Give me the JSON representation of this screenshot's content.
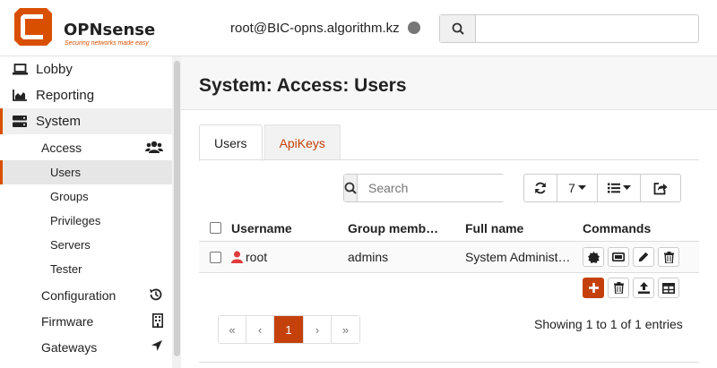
{
  "header": {
    "brand": "OPNsense",
    "tagline": "Securing networks made easy",
    "user_host": "root@BIC-opns.algorithm.kz",
    "search_placeholder": ""
  },
  "sidebar": {
    "items": [
      {
        "label": "Lobby",
        "icon": "laptop-icon"
      },
      {
        "label": "Reporting",
        "icon": "area-chart-icon"
      },
      {
        "label": "System",
        "icon": "server-icon"
      }
    ],
    "system_children": [
      {
        "label": "Access",
        "icon": "users-icon"
      },
      {
        "label": "Users"
      },
      {
        "label": "Groups"
      },
      {
        "label": "Privileges"
      },
      {
        "label": "Servers"
      },
      {
        "label": "Tester"
      },
      {
        "label": "Configuration",
        "icon": "history-icon"
      },
      {
        "label": "Firmware",
        "icon": "building-icon"
      },
      {
        "label": "Gateways",
        "icon": "location-arrow-icon"
      }
    ]
  },
  "page": {
    "title": "System: Access: Users",
    "tabs": [
      {
        "label": "Users",
        "active": true
      },
      {
        "label": "ApiKeys",
        "active": false
      }
    ]
  },
  "grid": {
    "search_placeholder": "Search",
    "page_size": "7",
    "columns": [
      "Username",
      "Group memb…",
      "Full name",
      "Commands"
    ],
    "rows": [
      {
        "username": "root",
        "groups": "admins",
        "full_name": "System Administ…"
      }
    ],
    "pagination": [
      "«",
      "‹",
      "1",
      "›",
      "»"
    ],
    "current_page": "1",
    "showing": "Showing 1 to 1 of 1 entries"
  },
  "colors": {
    "accent": "#c4410b",
    "brand_orange": "#d94f00",
    "status_dot": "#777777"
  }
}
